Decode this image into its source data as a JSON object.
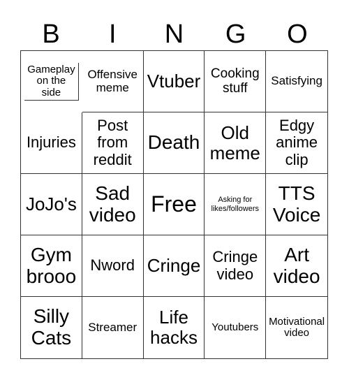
{
  "header": [
    "B",
    "I",
    "N",
    "G",
    "O"
  ],
  "cells": [
    "Gameplay on the side",
    "Offensive meme",
    "Vtuber",
    "Cooking stuff",
    "Satisfying",
    "Injuries",
    "Post from reddit",
    "Death",
    "Old meme",
    "Edgy anime clip",
    "JoJo's",
    "Sad video",
    "Free",
    "Asking for likes/followers",
    "TTS Voice",
    "Gym brooo",
    "Nword",
    "Cringe",
    "Cringe video",
    "Art video",
    "Silly Cats",
    "Streamer",
    "Life hacks",
    "Youtubers",
    "Motivational video"
  ]
}
